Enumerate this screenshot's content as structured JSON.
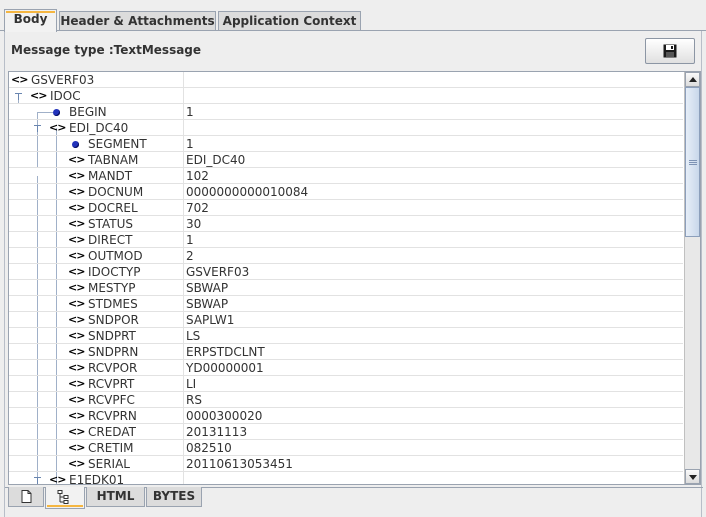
{
  "tabs": {
    "body": "Body",
    "header_attachments": "Header & Attachments",
    "application_context": "Application Context"
  },
  "message_type_label": "Message type :TextMessage",
  "icons": {
    "save": "floppy-disk-icon",
    "node": "tag-brackets-icon",
    "leaf": "blue-dot-icon",
    "doc_view": "document-icon",
    "tree_view": "tree-icon"
  },
  "colors": {
    "active_tab_accent": "#f5b641",
    "leaf_dot": "#2233bb",
    "tree_line": "#a0b0c8"
  },
  "tree": {
    "rows": [
      {
        "name": "GSVERF03",
        "value": ""
      },
      {
        "name": "IDOC",
        "value": ""
      },
      {
        "name": "BEGIN",
        "value": "1"
      },
      {
        "name": "EDI_DC40",
        "value": ""
      },
      {
        "name": "SEGMENT",
        "value": "1"
      },
      {
        "name": "TABNAM",
        "value": "EDI_DC40"
      },
      {
        "name": "MANDT",
        "value": "102"
      },
      {
        "name": "DOCNUM",
        "value": "0000000000010084"
      },
      {
        "name": "DOCREL",
        "value": "702"
      },
      {
        "name": "STATUS",
        "value": "30"
      },
      {
        "name": "DIRECT",
        "value": "1"
      },
      {
        "name": "OUTMOD",
        "value": "2"
      },
      {
        "name": "IDOCTYP",
        "value": "GSVERF03"
      },
      {
        "name": "MESTYP",
        "value": "SBWAP"
      },
      {
        "name": "STDMES",
        "value": "SBWAP"
      },
      {
        "name": "SNDPOR",
        "value": "SAPLW1"
      },
      {
        "name": "SNDPRT",
        "value": "LS"
      },
      {
        "name": "SNDPRN",
        "value": "ERPSTDCLNT"
      },
      {
        "name": "RCVPOR",
        "value": "YD00000001"
      },
      {
        "name": "RCVPRT",
        "value": "LI"
      },
      {
        "name": "RCVPFC",
        "value": "RS"
      },
      {
        "name": "RCVPRN",
        "value": "0000300020"
      },
      {
        "name": "CREDAT",
        "value": "20131113"
      },
      {
        "name": "CRETIM",
        "value": "082510"
      },
      {
        "name": "SERIAL",
        "value": "20110613053451"
      },
      {
        "name": "E1EDK01",
        "value": ""
      }
    ]
  },
  "bottom_tabs": {
    "html": "HTML",
    "bytes": "BYTES"
  }
}
